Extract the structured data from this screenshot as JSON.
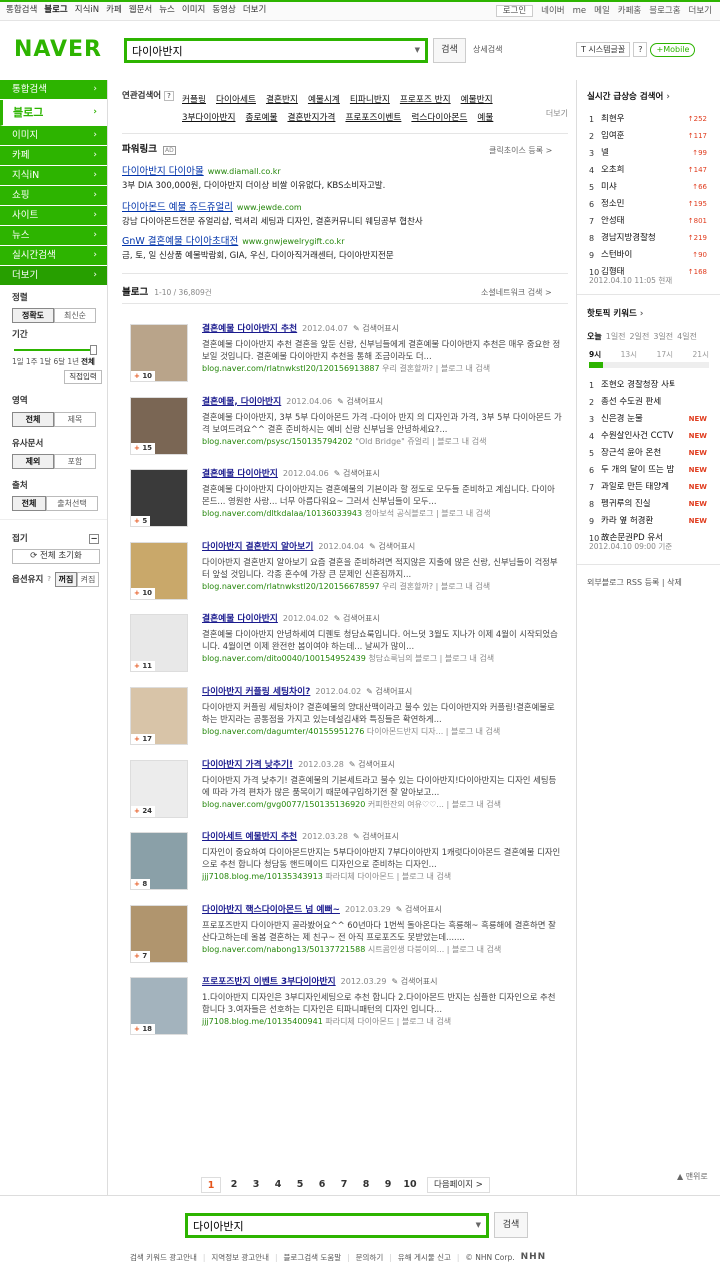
{
  "topnav": {
    "items": [
      "통합검색",
      "블로그",
      "지식iN",
      "카페",
      "웹문서",
      "뉴스",
      "이미지",
      "동영상",
      "더보기"
    ],
    "login": "로그인",
    "right": [
      "네이버",
      "me",
      "메일",
      "카페홈",
      "블로그홈",
      "더보기"
    ]
  },
  "header": {
    "logo": "NAVER",
    "query": "다이아반지",
    "search_btn": "검색",
    "detail": "상세검색",
    "font_btn": "T 시스템글꼴",
    "help": "?",
    "mobile": "+Mobile"
  },
  "leftnav": {
    "items": [
      {
        "label": "통합검색"
      },
      {
        "label": "블로그",
        "current": true
      },
      {
        "label": "이미지"
      },
      {
        "label": "카페"
      },
      {
        "label": "지식iN"
      },
      {
        "label": "쇼핑"
      },
      {
        "label": "사이트"
      },
      {
        "label": "뉴스"
      },
      {
        "label": "실시간검색"
      },
      {
        "label": "더보기"
      }
    ],
    "sort_title": "정렬",
    "sort": [
      "정확도",
      "최신순"
    ],
    "period_title": "기간",
    "period_ticks": [
      "1일",
      "1주",
      "1달",
      "6달",
      "1년",
      "전체"
    ],
    "period_direct": "직접입력",
    "area_title": "영역",
    "area": [
      "전체",
      "제목"
    ],
    "similar_title": "유사문서",
    "similar": [
      "제외",
      "포함"
    ],
    "source_title": "출처",
    "source": [
      "전체",
      "출처선택"
    ],
    "fold_title": "접기",
    "reset": "전체 초기화",
    "option_title": "옵션유지",
    "option": [
      "꺼짐",
      "켜짐"
    ]
  },
  "related": {
    "label": "연관검색어",
    "help": "?",
    "words": [
      "커플링",
      "다이아세트",
      "결혼반지",
      "예물시계",
      "티파니반지",
      "프로포즈 반지",
      "예물반지",
      "3부다이아반지",
      "종로예물",
      "결혼반지가격",
      "프로포즈이벤트",
      "럭스다이아몬드",
      "예물"
    ],
    "fold": "더보기"
  },
  "powerlink": {
    "title": "파워링크",
    "ad": "AD",
    "register": "클릭초이스 등록 >",
    "ads": [
      {
        "title": "다이아반지 다이아몰",
        "url": "www.diamall.co.kr",
        "desc": "3부 DIA 300,000원, 다이아반지 더이상 비쌀 이유없다, KBS소비자고발."
      },
      {
        "title": "다이아몬드 예물 쥬드쥬얼리",
        "url": "www.jewde.com",
        "desc": "강남 다이아몬드전문 쥬얼리샵, 럭셔리 세팅과 디자인, 결혼커뮤니티 웨딩공부 협찬사"
      },
      {
        "title": "GnW 결혼예물 다이아초대전",
        "url": "www.gnwjewelrygift.co.kr",
        "desc": "금, 토, 일 신상품 예물박람회, GIA, 우신, 다이아직거래센터, 다이아반지전문"
      }
    ]
  },
  "blog": {
    "title": "블로그",
    "count": "1-10 / 36,809건",
    "social": "소셜네트워크 검색 >",
    "posts": [
      {
        "title": "결혼예물 다이아반지 추천",
        "date": "2012.04.07",
        "extra": "검색어표시",
        "desc": "결혼예물 다이아반지 추천 결혼을 앞둔 신랑, 신부님들에게 결혼예물 다이아반지 추천은 매우 중요한 정보일 것입니다. 결혼예물 다이아반지 추천을 통해 조금이라도 더...",
        "url": "blog.naver.com/rlatnwkstl20/120156913887",
        "blog": "우리 결혼할까?",
        "inblog": "블로그 내 검색",
        "count": "10",
        "color": "#b9a48a"
      },
      {
        "title": "결혼예물, 다이아반지",
        "date": "2012.04.06",
        "extra": "검색어표시",
        "desc": "결혼예물 다이아반지, 3부 5부 다이아몬드 가격 -다이아 반지 의 디자인과 가격, 3부 5부 다이아몬드 가격 보여드려요^^ 결혼 준비하시는 예비 신랑 신부님을 안녕하세요?...",
        "url": "blog.naver.com/psysc/150135794202",
        "blog": "\"Old Bridge\" 쥬얼리",
        "inblog": "블로그 내 검색",
        "count": "15",
        "color": "#7a6654"
      },
      {
        "title": "결혼예물 다이아반지",
        "date": "2012.04.06",
        "extra": "검색어표시",
        "desc": "결혼예물 다이아반지 다이아반지는 결혼예물의 기본이라 할 정도로 모두들 준비하고 계십니다. 다이아몬드... 영원한 사랑... 너무 아름다워요~ 그러서 신부님들이 모두...",
        "url": "blog.naver.com/dltkdalaa/10136033943",
        "blog": "정아보석 공식블로그",
        "inblog": "블로그 내 검색",
        "count": "5",
        "color": "#3a3a3a"
      },
      {
        "title": "다이아반지 결혼반지 알아보기",
        "date": "2012.04.04",
        "extra": "검색어표시",
        "desc": "다이아반지 결혼반지 알아보기 요즘 결혼을 준비하려면 적지않은 지출에 많은 신랑, 신부님들이 걱정부터 앞설 것입니다. 각종 혼수에 가장 큰 문제인 신혼집까지...",
        "url": "blog.naver.com/rlatnwkstl20/120156678597",
        "blog": "우리 결혼할까?",
        "inblog": "블로그 내 검색",
        "count": "10",
        "color": "#c9a86a"
      },
      {
        "title": "결혼예물 다이아반지",
        "date": "2012.04.02",
        "extra": "검색어표시",
        "desc": "결혼예물 다이아반지 안녕하세여 디퀜토 청담쇼룩입니다. 어느덧 3월도 지나가 이제 4월이 시작되었습니다. 4월이면 이제 완전한 봄이여야 하는데... 날씨가 많이...",
        "url": "blog.naver.com/dito0040/100154952439",
        "blog": "청담쇼룩님의 블로그",
        "inblog": "블로그 내 검색",
        "count": "11",
        "color": "#e8e8e8"
      },
      {
        "title": "다이아반지 커플링 세팅차이?",
        "date": "2012.04.02",
        "extra": "검색어표시",
        "desc": "다이아반지 커플링 세팅차이? 결혼예물의 양대산맥이라고 불수 있는 다이아반지와 커플링!결혼예물로 하는 반지라는 공통점을 가지고 있는데설김새와 특징들은 확연하게...",
        "url": "blog.naver.com/dagumter/40155951276",
        "blog": "다이아몬드반지 디자...",
        "inblog": "블로그 내 검색",
        "count": "17",
        "color": "#d8c4a8"
      },
      {
        "title": "다이아반지 가격 낮추기!",
        "date": "2012.03.28",
        "extra": "검색어표시",
        "desc": "다이아반지 가격 낮추기! 결혼예물의 기본세트라고 불수 있는 다이아반지!다이아반지는 디자인 세팅등에 따라 가격 편차가 많은 품목이기 때문에구입하기전 잘 알아보고...",
        "url": "blog.naver.com/gvg0077/150135136920",
        "blog": "커피한잔의 여유♡♡...",
        "inblog": "블로그 내 검색",
        "count": "24",
        "color": "#ececec"
      },
      {
        "title": "다이아세트 예물반지 추천",
        "date": "2012.03.28",
        "extra": "검색어표시",
        "desc": "디자인이 중요하여 다이아몬드반지는 5부다이아반지 7부다이아반지 1캐럿다이아몬드 결혼예물 디자인으로 추천 합니다 청담동 핸드메이드 디자인으로 준비하는 디자인...",
        "url": "jjj7108.blog.me/10135343913",
        "blog": "파라디체 다이아몬드",
        "inblog": "블로그 내 검색",
        "count": "8",
        "color": "#8aa0a8"
      },
      {
        "title": "다이아반지 핵스다이아몬드 넘 예뻐~",
        "date": "2012.03.29",
        "extra": "검색어표시",
        "desc": "프로포즈반지 다이아반지 골라봤어요^^ 60년마다 1번씩 돌아온다는 흑룡해~ 흑룡해에 결혼하면 잘산다고하는데 올봄 결혼하는 제 친구~ 전 아직 프로포즈도 못받았는데.......",
        "url": "blog.naver.com/nabong13/50137721588",
        "blog": "시트콤인생 다붕이의...",
        "inblog": "블로그 내 검색",
        "count": "7",
        "color": "#b0956e"
      },
      {
        "title": "프로포즈반지 이벤트 3부다이아반지",
        "date": "2012.03.29",
        "extra": "검색어표시",
        "desc": "1.다이아반지 디자인은 3부디자인세팅으로 추천 합니다 2.다이아몬드 반지는 심플한 디자인으로 추천 합니다 3.여자들은 선호하는 디자인은 티파니패턴의 디자인 입니다...",
        "url": "jjj7108.blog.me/10135400941",
        "blog": "파라디체 다이아몬드",
        "inblog": "블로그 내 검색",
        "count": "18",
        "color": "#a3b3bd"
      }
    ]
  },
  "pager": {
    "pages": [
      "1",
      "2",
      "3",
      "4",
      "5",
      "6",
      "7",
      "8",
      "9",
      "10"
    ],
    "current": "1",
    "next": "다음페이지 >"
  },
  "right": {
    "rt_title": "실시간 급상승 검색어",
    "realtime": [
      {
        "n": "1",
        "w": "최현우",
        "v": "↑252"
      },
      {
        "n": "2",
        "w": "임여훈",
        "v": "↑117"
      },
      {
        "n": "3",
        "w": "넬",
        "v": "↑99"
      },
      {
        "n": "4",
        "w": "오초희",
        "v": "↑147"
      },
      {
        "n": "5",
        "w": "미샤",
        "v": "↑66"
      },
      {
        "n": "6",
        "w": "정소민",
        "v": "↑195"
      },
      {
        "n": "7",
        "w": "안성태",
        "v": "↑801"
      },
      {
        "n": "8",
        "w": "경남지방경찰청",
        "v": "↑219"
      },
      {
        "n": "9",
        "w": "스턴바이",
        "v": "↑90"
      },
      {
        "n": "10",
        "w": "김형태",
        "v": "↑168"
      }
    ],
    "rt_stamp": "2012.04.10 11:05 현재",
    "hot_title": "핫토픽 키워드",
    "hot_tabs": [
      "오늘",
      "1일전",
      "2일전",
      "3일전",
      "4일전"
    ],
    "timeline": [
      "9시",
      "13시",
      "17시",
      "21시"
    ],
    "hot": [
      {
        "n": "1",
        "w": "조현오 경찰청장 사퇴",
        "v": ""
      },
      {
        "n": "2",
        "w": "총선 수도권 판세",
        "v": ""
      },
      {
        "n": "3",
        "w": "신은경 눈물",
        "v": "NEW"
      },
      {
        "n": "4",
        "w": "수원살인사건 CCTV",
        "v": "NEW"
      },
      {
        "n": "5",
        "w": "장근석 윤아 온천",
        "v": "NEW"
      },
      {
        "n": "6",
        "w": "두 개의 달이 뜨는 밤",
        "v": "NEW"
      },
      {
        "n": "7",
        "w": "과일로 만든 태양계",
        "v": "NEW"
      },
      {
        "n": "8",
        "w": "펭귀루의 진실",
        "v": "NEW"
      },
      {
        "n": "9",
        "w": "카라 옆 허경환",
        "v": "NEW"
      },
      {
        "n": "10",
        "w": "故손문권PD 유서",
        "v": ""
      }
    ],
    "hot_stamp": "2012.04.10 09:00 기준",
    "rss": "외부블로그 RSS 등록",
    "del": "삭제"
  },
  "footer": {
    "query": "다이아반지",
    "btn": "검색",
    "fold_top": "▲ 맨위로",
    "links": [
      "검색 키워드 광고안내",
      "지역정보 광고안내",
      "블로그검색 도움말",
      "문의하기",
      "유해 게시물 신고"
    ],
    "copy": "© NHN Corp.",
    "nhn": "NHN"
  }
}
